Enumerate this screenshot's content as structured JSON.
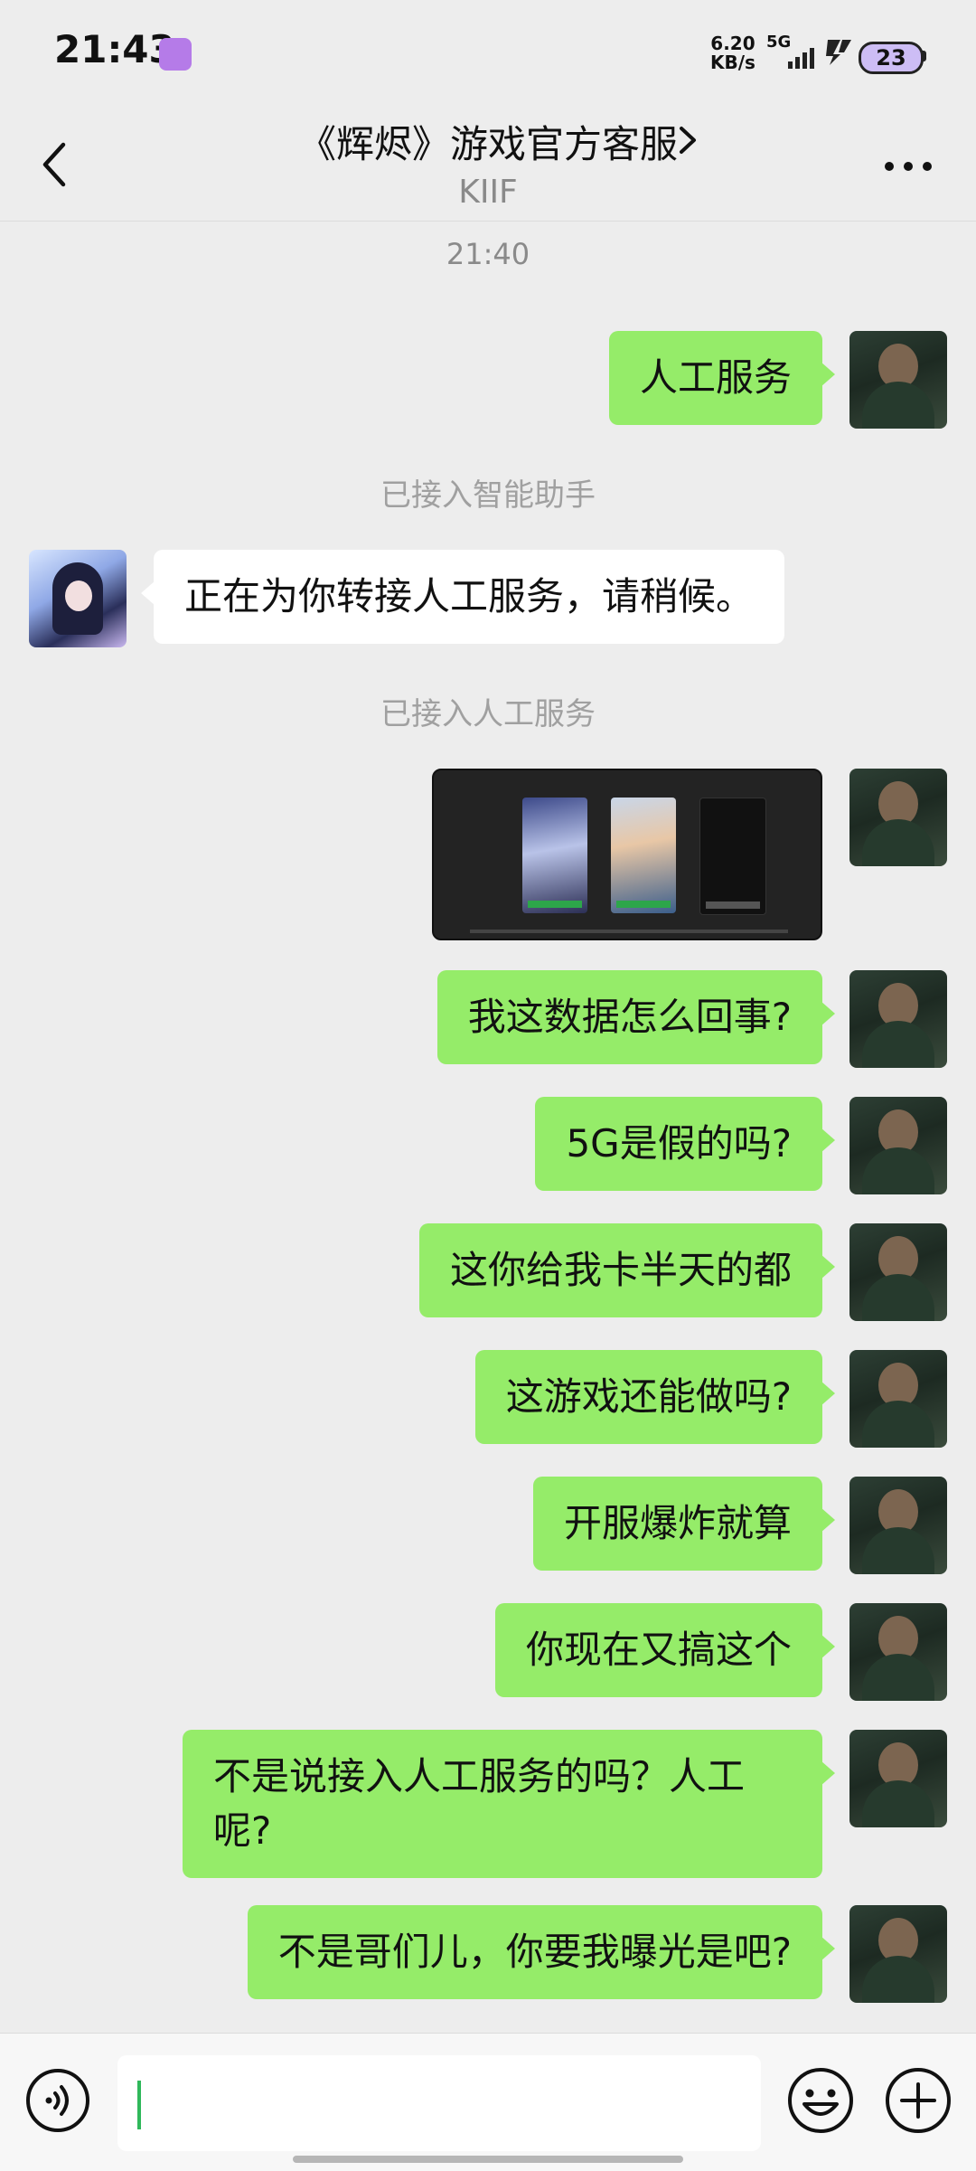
{
  "status_bar": {
    "time": "21:43",
    "net_speed": "6.20",
    "net_unit": "KB/s",
    "signal": "5G",
    "battery": "23"
  },
  "header": {
    "title": "《辉烬》游戏官方客服",
    "subtitle": "KIIF"
  },
  "chat": {
    "timestamp": "21:40",
    "system_1": "已接入智能助手",
    "system_2": "已接入人工服务",
    "messages": [
      {
        "from": "me",
        "text": "人工服务"
      },
      {
        "from": "bot",
        "text": "正在为你转接人工服务，请稍候。"
      },
      {
        "from": "me",
        "text": "我这数据怎么回事?"
      },
      {
        "from": "me",
        "text": "5G是假的吗?"
      },
      {
        "from": "me",
        "text": "这你给我卡半天的都"
      },
      {
        "from": "me",
        "text": "这游戏还能做吗?"
      },
      {
        "from": "me",
        "text": "开服爆炸就算"
      },
      {
        "from": "me",
        "text": "你现在又搞这个"
      },
      {
        "from": "me",
        "text": "不是说接入人工服务的吗？人工呢?"
      },
      {
        "from": "me",
        "text": "不是哥们儿，你要我曝光是吧?"
      }
    ]
  },
  "colors": {
    "background": "#ededed",
    "my_bubble": "#95ec69",
    "bot_bubble": "#ffffff",
    "caret": "#2fb85a"
  }
}
